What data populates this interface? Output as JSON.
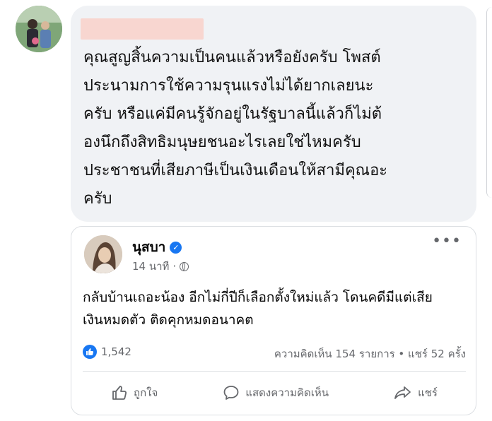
{
  "comment": {
    "text": "คุณสูญสิ้นความเป็นคนแล้วหรือยังครับ โพสต์\nประนามการใช้ความรุนแรงไม่ได้ยากเลยนะ\nครับ หรือแค่มีคนรู้จักอยู่ในรัฐบาลนี้แล้วก็ไม่ต้\nองนึกถึงสิทธิมนุษยชนอะไรเลยใช่ไหมครับ\nประชาชนที่เสียภาษีเป็นเงินเดือนให้สามีคุณอะ\nครับ"
  },
  "post": {
    "author": "นุสบา",
    "time": "14 นาที",
    "separator": "·",
    "text": "กลับบ้านเถอะน้อง อีกไม่กี่ปีก็เลือกตั้งใหม่แล้ว โดนคดีมีแต่เสีย\nเงินหมดตัว ติดคุกหมดอนาคต",
    "reaction_count": "1,542",
    "comment_share": "ความคิดเห็น 154 รายการ • แชร์ 52 ครั้ง",
    "more": "•••",
    "actions": {
      "like": "ถูกใจ",
      "comment": "แสดงความคิดเห็น",
      "share": "แชร์"
    }
  },
  "icons": {
    "verified": "verified-badge-icon",
    "globe": "globe-icon",
    "like": "thumbs-up-icon",
    "comment": "speech-bubble-icon",
    "share": "share-arrow-icon"
  },
  "colors": {
    "bubble": "#f0f2f5",
    "accent": "#1877f2",
    "muted": "#65676b",
    "redaction": "#f8d6d0"
  }
}
